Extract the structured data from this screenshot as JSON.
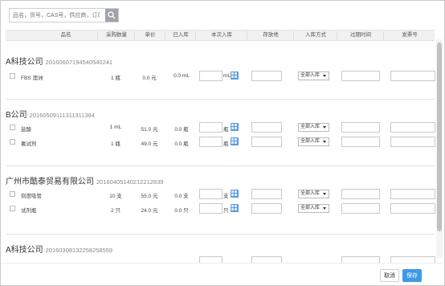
{
  "search": {
    "placeholder": "品名，货号，CAS号，供应商，订单"
  },
  "columns": [
    "品名",
    "采购数量",
    "单价",
    "已入库",
    "本次入库",
    "存放地",
    "入库方式",
    "过期时间",
    "发票号"
  ],
  "groups": [
    {
      "name": "A科技公司",
      "code": "20160607194540540241",
      "items": [
        {
          "name": "FBS 澳洲",
          "qty": "1 瓶",
          "price": "0.0 元",
          "received": "0.0 mL",
          "unit": "mL",
          "method": "全部入库"
        }
      ]
    },
    {
      "name": "B公司",
      "code": "20160509111311311384",
      "items": [
        {
          "name": "盐酸",
          "qty": "1 mL",
          "price": "51.0 元",
          "received": "0.0 瓶",
          "unit": "瓶",
          "method": "全部入库"
        },
        {
          "name": "氟试剂",
          "qty": "1 瓶",
          "price": "49.0 元",
          "received": "0.0 瓶",
          "unit": "瓶",
          "method": "全部入库"
        }
      ]
    },
    {
      "name": "广州市酷泰贸易有限公司",
      "code": "20160405140212212839",
      "items": [
        {
          "name": "刻度吸管",
          "qty": "10 支",
          "price": "55.0 元",
          "received": "0.0 支",
          "unit": "支",
          "method": "全部入库"
        },
        {
          "name": "试剂瓶",
          "qty": "2 只",
          "price": "24.0 元",
          "received": "0.0 只",
          "unit": "只",
          "method": "全部入库"
        }
      ]
    },
    {
      "name": "A科技公司",
      "code": "20160308132258258559",
      "items": []
    }
  ],
  "footer": {
    "cancel_label": "取消",
    "save_label": "保存"
  },
  "colors": {
    "primary": "#3f9ae5",
    "calc_icon": "#5b9bd5",
    "header_bg": "#f1f1f1"
  },
  "icons": {
    "search": "search-icon",
    "calculator": "calculator-icon",
    "dropdown": "chevron-down-icon"
  }
}
